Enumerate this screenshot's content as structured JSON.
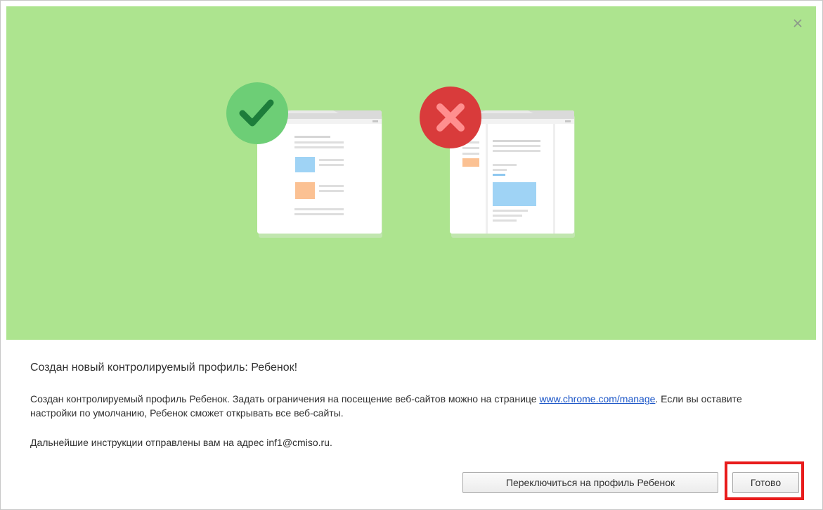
{
  "dialog": {
    "close_icon": "close-icon",
    "heading": "Создан новый контролируемый профиль: Ребенок!",
    "body": {
      "text_before_link": "Создан контролируемый профиль Ребенок. Задать ограничения на посещение веб-сайтов можно на странице ",
      "link": "www.chrome.com/manage",
      "text_after_link": ". Если вы оставите настройки по умолчанию, Ребенок сможет открывать все веб-сайты."
    },
    "instructions": "Дальнейшие инструкции отправлены вам на адрес inf1@cmiso.ru.",
    "buttons": {
      "switch_label": "Переключиться на профиль Ребенок",
      "done_label": "Готово"
    }
  },
  "illustration": {
    "allowed_icon": "check-circle-icon",
    "blocked_icon": "x-circle-icon"
  },
  "colors": {
    "hero_background": "#ade48f",
    "check_green": "#6dce76",
    "block_red": "#d93b3b",
    "link": "#1a55c7",
    "highlight": "#e81c1c"
  }
}
